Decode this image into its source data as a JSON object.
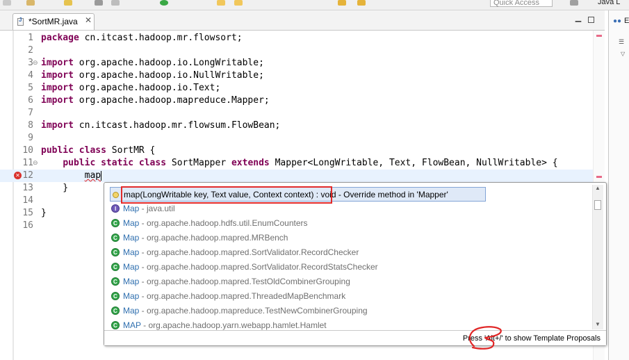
{
  "toolbar": {
    "quick_access_placeholder": "Quick Access",
    "perspective_label": "Java L"
  },
  "editor_tab": {
    "label": "*SortMR.java",
    "close_glyph": "✕"
  },
  "right_panel": {
    "label": "E"
  },
  "code_lines": [
    {
      "num": "1",
      "parts": [
        [
          "kw",
          "package"
        ],
        [
          "t",
          " cn.itcast.hadoop.mr.flowsort;"
        ]
      ]
    },
    {
      "num": "2",
      "parts": []
    },
    {
      "num": "3",
      "parts": [
        [
          "kw",
          "import"
        ],
        [
          "t",
          " org.apache.hadoop.io.LongWritable;"
        ]
      ]
    },
    {
      "num": "4",
      "parts": [
        [
          "kw",
          "import"
        ],
        [
          "t",
          " org.apache.hadoop.io.NullWritable;"
        ]
      ]
    },
    {
      "num": "5",
      "parts": [
        [
          "kw",
          "import"
        ],
        [
          "t",
          " org.apache.hadoop.io.Text;"
        ]
      ]
    },
    {
      "num": "6",
      "parts": [
        [
          "kw",
          "import"
        ],
        [
          "t",
          " org.apache.hadoop.mapreduce.Mapper;"
        ]
      ]
    },
    {
      "num": "7",
      "parts": []
    },
    {
      "num": "8",
      "parts": [
        [
          "kw",
          "import"
        ],
        [
          "t",
          " cn.itcast.hadoop.mr.flowsum.FlowBean;"
        ]
      ]
    },
    {
      "num": "9",
      "parts": []
    },
    {
      "num": "10",
      "parts": [
        [
          "kw",
          "public"
        ],
        [
          "t",
          " "
        ],
        [
          "kw",
          "class"
        ],
        [
          "t",
          " SortMR {"
        ]
      ]
    },
    {
      "num": "11",
      "parts": [
        [
          "t",
          "    "
        ],
        [
          "kw",
          "public"
        ],
        [
          "t",
          " "
        ],
        [
          "kw",
          "static"
        ],
        [
          "t",
          " "
        ],
        [
          "kw",
          "class"
        ],
        [
          "t",
          " SortMapper "
        ],
        [
          "kw",
          "extends"
        ],
        [
          "t",
          " Mapper<LongWritable, Text, FlowBean, NullWritable> {"
        ]
      ]
    },
    {
      "num": "12",
      "parts": [
        [
          "t",
          "        "
        ],
        [
          "err",
          "map"
        ]
      ]
    },
    {
      "num": "13",
      "parts": [
        [
          "t",
          "    }"
        ]
      ]
    },
    {
      "num": "14",
      "parts": []
    },
    {
      "num": "15",
      "parts": [
        [
          "t",
          "}"
        ]
      ]
    },
    {
      "num": "16",
      "parts": []
    }
  ],
  "proposals": [
    {
      "kind": "method",
      "name": "map(LongWritable key, Text value, Context context)",
      "sep": " : ",
      "detail": "void - Override method in 'Mapper'"
    },
    {
      "kind": "interface",
      "name": "Map",
      "sep": " - ",
      "detail": "java.util"
    },
    {
      "kind": "class",
      "name": "Map",
      "sep": " - ",
      "detail": "org.apache.hadoop.hdfs.util.EnumCounters"
    },
    {
      "kind": "class",
      "name": "Map",
      "sep": " - ",
      "detail": "org.apache.hadoop.mapred.MRBench"
    },
    {
      "kind": "class",
      "name": "Map",
      "sep": " - ",
      "detail": "org.apache.hadoop.mapred.SortValidator.RecordChecker"
    },
    {
      "kind": "class",
      "name": "Map",
      "sep": " - ",
      "detail": "org.apache.hadoop.mapred.SortValidator.RecordStatsChecker"
    },
    {
      "kind": "class",
      "name": "Map",
      "sep": " - ",
      "detail": "org.apache.hadoop.mapred.TestOldCombinerGrouping"
    },
    {
      "kind": "class",
      "name": "Map",
      "sep": " - ",
      "detail": "org.apache.hadoop.mapred.ThreadedMapBenchmark"
    },
    {
      "kind": "class",
      "name": "Map",
      "sep": " - ",
      "detail": "org.apache.hadoop.mapreduce.TestNewCombinerGrouping"
    },
    {
      "kind": "class",
      "name": "MAP",
      "sep": " - ",
      "detail": "org.apache.hadoop.yarn.webapp.hamlet.Hamlet"
    }
  ],
  "popup_footer": "Press 'Alt+/' to show Template Proposals",
  "colors": {
    "keyword": "#7f0055",
    "current_line": "#e8f2fe",
    "highlight_annotation": "#e22a2a",
    "error": "#d9322d"
  }
}
